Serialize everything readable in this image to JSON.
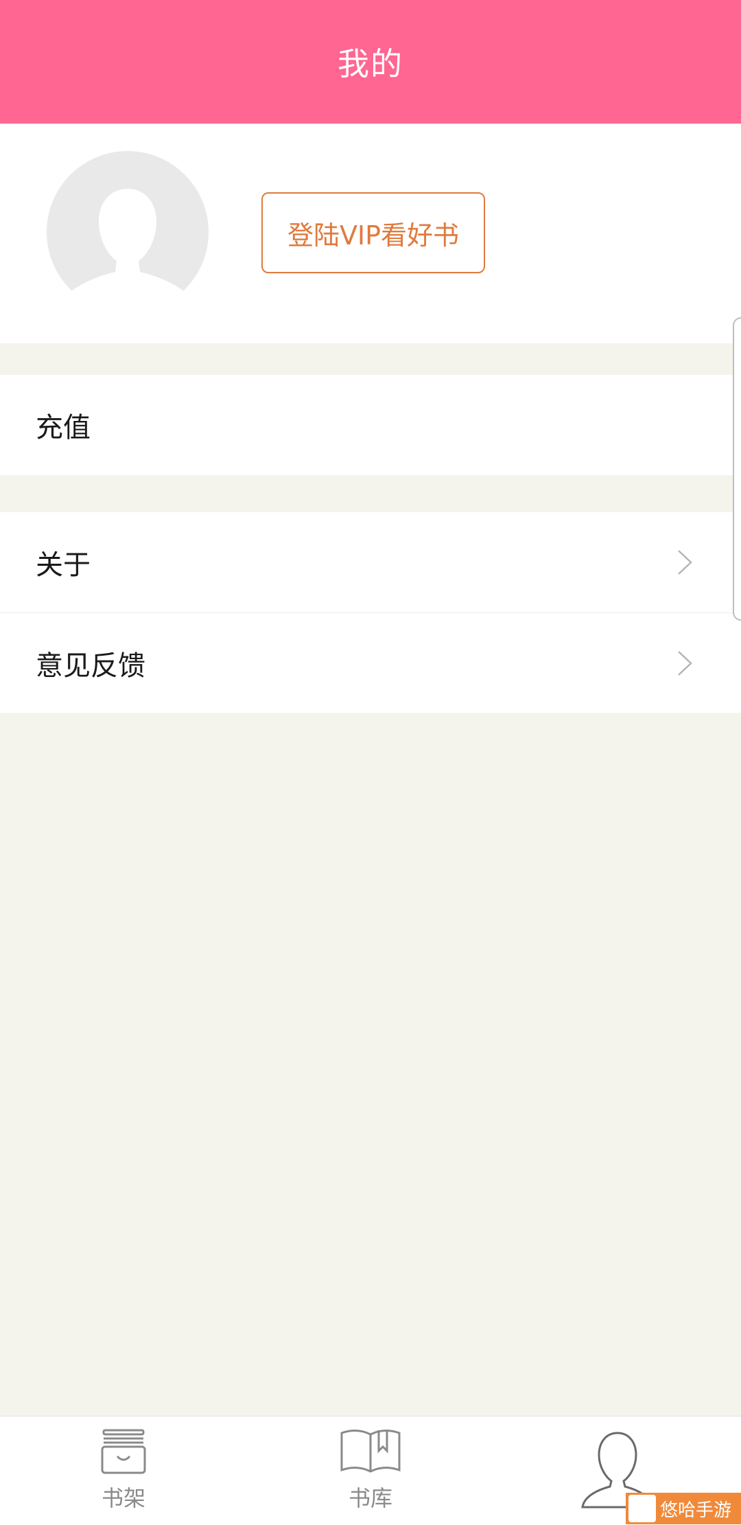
{
  "header": {
    "title": "我的"
  },
  "profile": {
    "login_button_label": "登陆VIP看好书"
  },
  "menu": {
    "recharge": {
      "label": "充值"
    },
    "about": {
      "label": "关于"
    },
    "feedback": {
      "label": "意见反馈"
    }
  },
  "tabbar": {
    "tabs": [
      {
        "label": "书架",
        "icon": "bookshelf-icon"
      },
      {
        "label": "书库",
        "icon": "open-book-icon"
      },
      {
        "label": "",
        "icon": "user-icon"
      }
    ]
  },
  "watermark": {
    "text": "悠哈手游"
  },
  "colors": {
    "header_bg": "#ff6691",
    "accent_orange": "#e07a3c",
    "page_bg": "#f5f4ec"
  }
}
